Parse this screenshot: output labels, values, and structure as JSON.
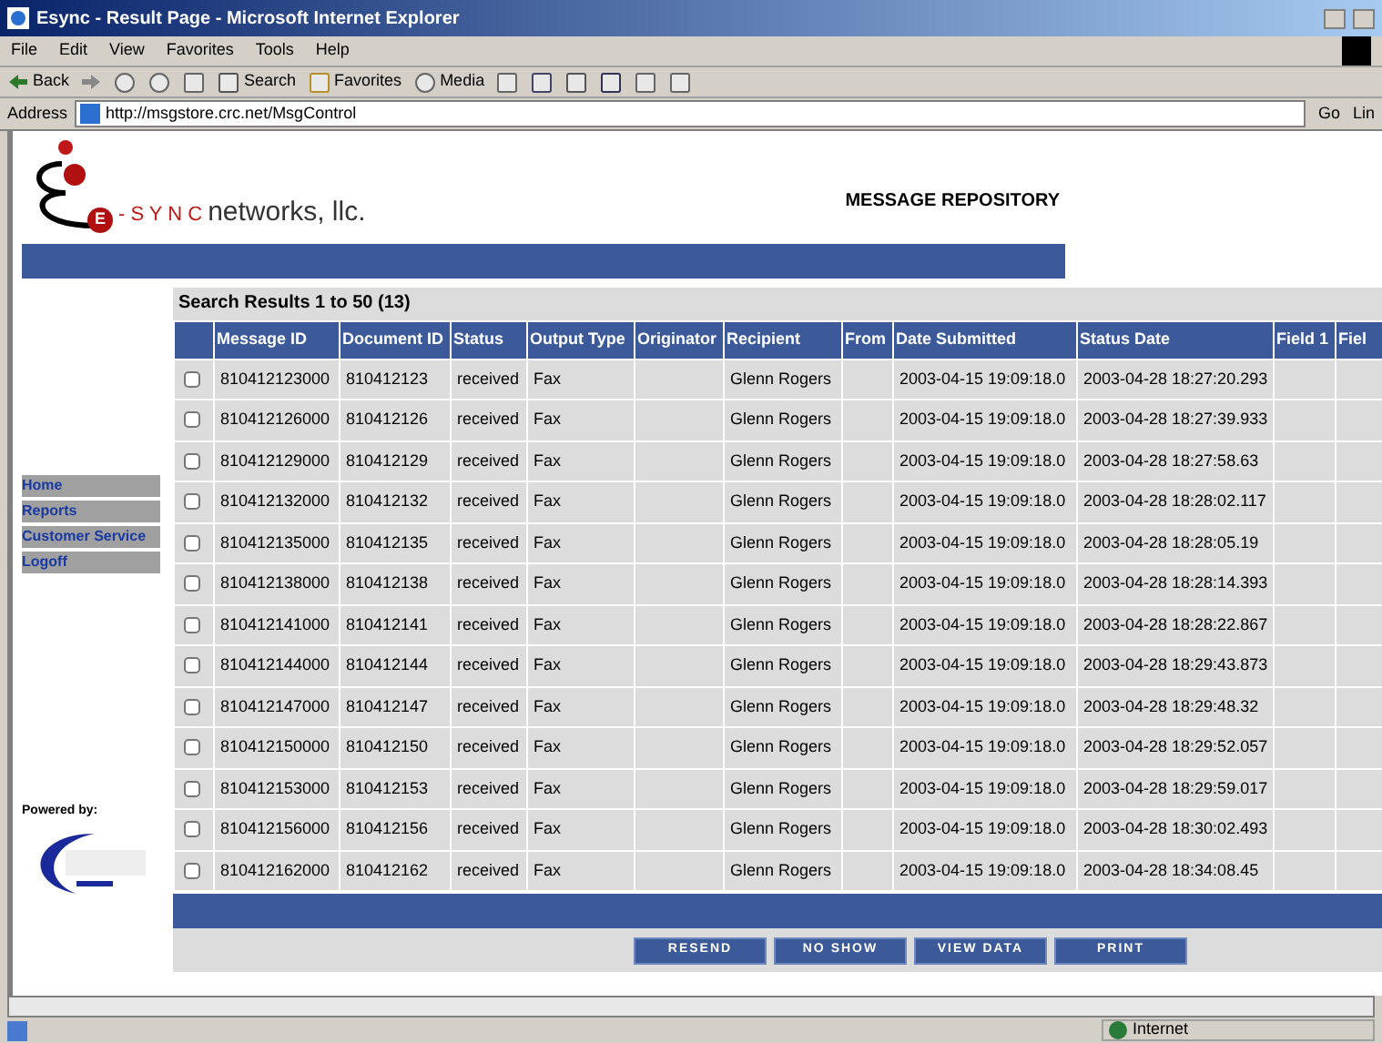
{
  "window": {
    "title": "Esync - Result Page - Microsoft Internet Explorer"
  },
  "menu": [
    "File",
    "Edit",
    "View",
    "Favorites",
    "Tools",
    "Help"
  ],
  "toolbar": [
    {
      "kind": "back",
      "label": "Back"
    },
    {
      "kind": "forward"
    },
    {
      "kind": "stop"
    },
    {
      "kind": "refresh"
    },
    {
      "kind": "home"
    },
    {
      "kind": "search",
      "label": "Search"
    },
    {
      "kind": "favorites",
      "label": "Favorites"
    },
    {
      "kind": "media",
      "label": "Media"
    },
    {
      "kind": "history"
    },
    {
      "kind": "mail"
    },
    {
      "kind": "print"
    },
    {
      "kind": "edit"
    },
    {
      "kind": "discuss"
    },
    {
      "kind": "messenger"
    }
  ],
  "address": {
    "label": "Address",
    "value": "http://msgstore.crc.net/MsgControl",
    "go": "Go",
    "links": "Lin"
  },
  "logo": {
    "letter": "E",
    "sync": "- S Y N C",
    "rest": "networks, llc."
  },
  "page_title": "MESSAGE REPOSITORY",
  "sidebar": {
    "items": [
      "Home",
      "Reports",
      "Customer Service",
      "Logoff"
    ],
    "powered_by": "Powered by:"
  },
  "results": {
    "heading": "Search Results 1 to 50 (13)",
    "columns": [
      "Message ID",
      "Document ID",
      "Status",
      "Output Type",
      "Originator",
      "Recipient",
      "From",
      "Date Submitted",
      "Status Date",
      "Field 1",
      "Fiel"
    ],
    "rows": [
      {
        "checked": false,
        "message_id": "810412123000",
        "document_id": "810412123",
        "status": "received",
        "output_type": "Fax",
        "recipient": "Glenn Rogers",
        "date_submitted": "2003-04-15 19:09:18.0",
        "status_date": "2003-04-28 18:27:20.293"
      },
      {
        "checked": false,
        "message_id": "810412126000",
        "document_id": "810412126",
        "status": "received",
        "output_type": "Fax",
        "recipient": "Glenn Rogers",
        "date_submitted": "2003-04-15 19:09:18.0",
        "status_date": "2003-04-28 18:27:39.933"
      },
      {
        "checked": false,
        "message_id": "810412129000",
        "document_id": "810412129",
        "status": "received",
        "output_type": "Fax",
        "recipient": "Glenn Rogers",
        "date_submitted": "2003-04-15 19:09:18.0",
        "status_date": "2003-04-28 18:27:58.63"
      },
      {
        "checked": false,
        "message_id": "810412132000",
        "document_id": "810412132",
        "status": "received",
        "output_type": "Fax",
        "recipient": "Glenn Rogers",
        "date_submitted": "2003-04-15 19:09:18.0",
        "status_date": "2003-04-28 18:28:02.117"
      },
      {
        "checked": false,
        "message_id": "810412135000",
        "document_id": "810412135",
        "status": "received",
        "output_type": "Fax",
        "recipient": "Glenn Rogers",
        "date_submitted": "2003-04-15 19:09:18.0",
        "status_date": "2003-04-28 18:28:05.19"
      },
      {
        "checked": false,
        "message_id": "810412138000",
        "document_id": "810412138",
        "status": "received",
        "output_type": "Fax",
        "recipient": "Glenn Rogers",
        "date_submitted": "2003-04-15 19:09:18.0",
        "status_date": "2003-04-28 18:28:14.393"
      },
      {
        "checked": false,
        "message_id": "810412141000",
        "document_id": "810412141",
        "status": "received",
        "output_type": "Fax",
        "recipient": "Glenn Rogers",
        "date_submitted": "2003-04-15 19:09:18.0",
        "status_date": "2003-04-28 18:28:22.867"
      },
      {
        "checked": false,
        "message_id": "810412144000",
        "document_id": "810412144",
        "status": "received",
        "output_type": "Fax",
        "recipient": "Glenn Rogers",
        "date_submitted": "2003-04-15 19:09:18.0",
        "status_date": "2003-04-28 18:29:43.873"
      },
      {
        "checked": false,
        "message_id": "810412147000",
        "document_id": "810412147",
        "status": "received",
        "output_type": "Fax",
        "recipient": "Glenn Rogers",
        "date_submitted": "2003-04-15 19:09:18.0",
        "status_date": "2003-04-28 18:29:48.32"
      },
      {
        "checked": false,
        "message_id": "810412150000",
        "document_id": "810412150",
        "status": "received",
        "output_type": "Fax",
        "recipient": "Glenn Rogers",
        "date_submitted": "2003-04-15 19:09:18.0",
        "status_date": "2003-04-28 18:29:52.057"
      },
      {
        "checked": false,
        "message_id": "810412153000",
        "document_id": "810412153",
        "status": "received",
        "output_type": "Fax",
        "recipient": "Glenn Rogers",
        "date_submitted": "2003-04-15 19:09:18.0",
        "status_date": "2003-04-28 18:29:59.017"
      },
      {
        "checked": false,
        "message_id": "810412156000",
        "document_id": "810412156",
        "status": "received",
        "output_type": "Fax",
        "recipient": "Glenn Rogers",
        "date_submitted": "2003-04-15 19:09:18.0",
        "status_date": "2003-04-28 18:30:02.493"
      },
      {
        "checked": false,
        "message_id": "810412162000",
        "document_id": "810412162",
        "status": "received",
        "output_type": "Fax",
        "recipient": "Glenn Rogers",
        "date_submitted": "2003-04-15 19:09:18.0",
        "status_date": "2003-04-28 18:34:08.45"
      }
    ],
    "buttons": [
      "RESEND",
      "NO SHOW",
      "VIEW DATA",
      "PRINT"
    ]
  },
  "status_bar": {
    "zone": "Internet"
  }
}
